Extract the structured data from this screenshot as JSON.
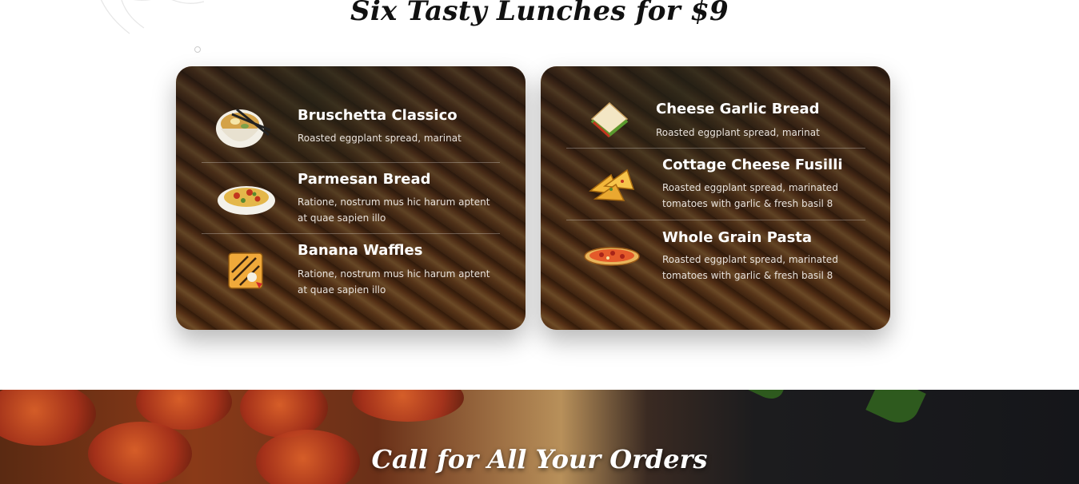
{
  "lunch_section": {
    "title": "Six Tasty Lunches for $9"
  },
  "menu_left": [
    {
      "name": "Bruschetta Classico",
      "desc": "Roasted eggplant spread, marinat",
      "icon": "soup-bowl-icon"
    },
    {
      "name": "Parmesan Bread",
      "desc": "Ratione, nostrum mus hic harum aptent at quae sapien illo",
      "icon": "pasta-plate-icon"
    },
    {
      "name": "Banana Waffles",
      "desc": "Ratione, nostrum mus hic harum aptent at quae sapien illo",
      "icon": "waffle-icon"
    }
  ],
  "menu_right": [
    {
      "name": "Cheese Garlic Bread",
      "desc": "Roasted eggplant spread, marinat",
      "icon": "sandwich-icon"
    },
    {
      "name": "Cottage Cheese Fusilli",
      "desc": "Roasted eggplant spread, marinated tomatoes with garlic & fresh basil 8",
      "icon": "quesadilla-icon"
    },
    {
      "name": "Whole Grain Pasta",
      "desc": "Roasted eggplant spread, marinated tomatoes with garlic & fresh basil 8",
      "icon": "pizza-icon"
    }
  ],
  "order_banner": {
    "title": "Call for All Your Orders"
  },
  "colors": {
    "heading": "#111111",
    "card_text": "#ffffff",
    "card_desc": "#e8e2dc"
  }
}
